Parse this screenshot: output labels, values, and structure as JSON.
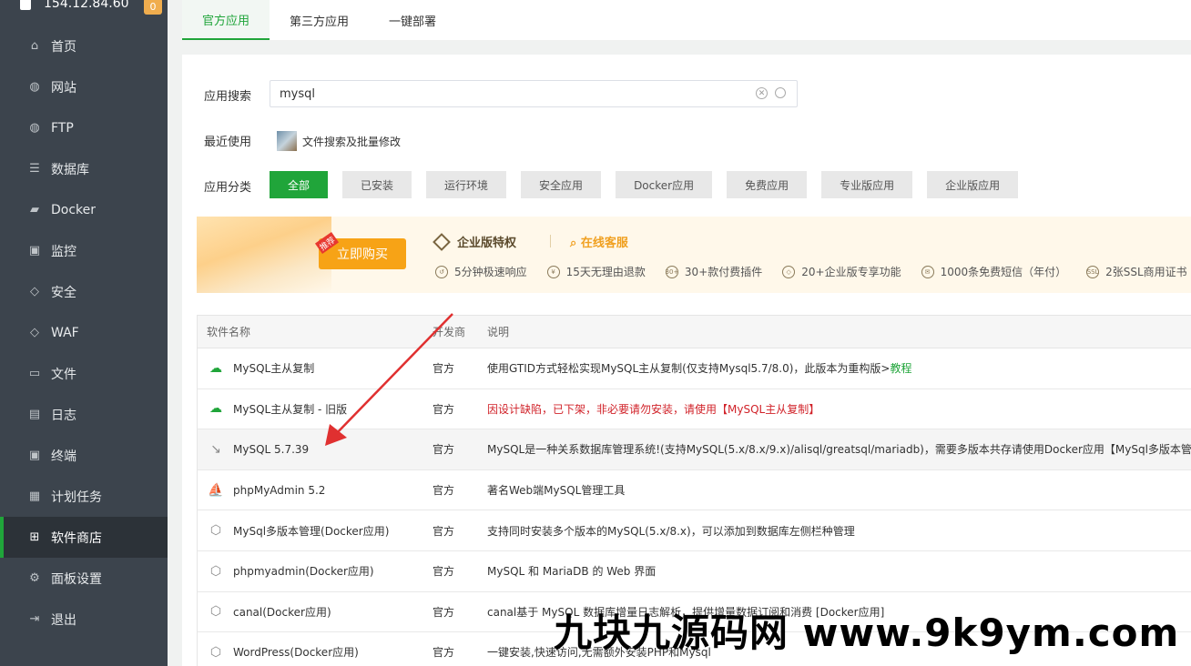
{
  "sidebar": {
    "host": "154.12.84.60",
    "badge": "0",
    "items": [
      {
        "label": "首页",
        "icon": "home-icon",
        "glyph": "⌂"
      },
      {
        "label": "网站",
        "icon": "globe-icon",
        "glyph": "◍"
      },
      {
        "label": "FTP",
        "icon": "ftp-icon",
        "glyph": "◍"
      },
      {
        "label": "数据库",
        "icon": "database-icon",
        "glyph": "☰"
      },
      {
        "label": "Docker",
        "icon": "docker-icon",
        "glyph": "▰"
      },
      {
        "label": "监控",
        "icon": "monitor-icon",
        "glyph": "▣"
      },
      {
        "label": "安全",
        "icon": "shield-icon",
        "glyph": "◇"
      },
      {
        "label": "WAF",
        "icon": "waf-icon",
        "glyph": "◇"
      },
      {
        "label": "文件",
        "icon": "folder-icon",
        "glyph": "▭"
      },
      {
        "label": "日志",
        "icon": "log-icon",
        "glyph": "▤"
      },
      {
        "label": "终端",
        "icon": "terminal-icon",
        "glyph": "▣"
      },
      {
        "label": "计划任务",
        "icon": "calendar-icon",
        "glyph": "▦"
      },
      {
        "label": "软件商店",
        "icon": "apps-icon",
        "glyph": "⊞"
      },
      {
        "label": "面板设置",
        "icon": "gear-icon",
        "glyph": "⚙"
      },
      {
        "label": "退出",
        "icon": "logout-icon",
        "glyph": "⇥"
      }
    ],
    "active_index": 12
  },
  "tabs": [
    "官方应用",
    "第三方应用",
    "一键部署"
  ],
  "search": {
    "label": "应用搜索",
    "value": "mysql"
  },
  "recent": {
    "label": "最近使用",
    "item": "文件搜索及批量修改"
  },
  "categories": {
    "label": "应用分类",
    "items": [
      "全部",
      "已安装",
      "运行环境",
      "安全应用",
      "Docker应用",
      "免费应用",
      "专业版应用",
      "企业版应用"
    ]
  },
  "banner": {
    "recommend": "推荐",
    "buy": "立即购买",
    "title": "企业版特权",
    "service": "在线客服",
    "perks": [
      {
        "text": "5分钟极速响应",
        "icon": "clock-icon",
        "glyph": "↺"
      },
      {
        "text": "15天无理由退款",
        "icon": "refund-icon",
        "glyph": "¥"
      },
      {
        "text": "30+款付费插件",
        "icon": "plugin-icon",
        "glyph": "30+"
      },
      {
        "text": "20+企业版专享功能",
        "icon": "diamond-icon",
        "glyph": "◇"
      },
      {
        "text": "1000条免费短信（年付）",
        "icon": "mail-icon",
        "glyph": "✉"
      },
      {
        "text": "2张SSL商用证书（",
        "icon": "ssl-icon",
        "glyph": "SSL"
      }
    ]
  },
  "table": {
    "headers": [
      "软件名称",
      "开发商",
      "说明"
    ],
    "rows": [
      {
        "name": "MySQL主从复制",
        "vendor": "官方",
        "desc": "使用GTID方式轻松实现MySQL主从复制(仅支持Mysql5.7/8.0)，此版本为重构版>",
        "link": "教程",
        "icon": "cloud-sync-icon",
        "glyph": "☁",
        "style": "green"
      },
      {
        "name": "MySQL主从复制 - 旧版",
        "vendor": "官方",
        "desc": "因设计缺陷，已下架，非必要请勿安装，请使用【MySQL主从复制】",
        "icon": "cloud-sync-icon",
        "glyph": "☁",
        "style": "green",
        "desc_style": "red"
      },
      {
        "name": "MySQL 5.7.39",
        "vendor": "官方",
        "desc": "MySQL是一种关系数据库管理系统!(支持MySQL(5.x/8.x/9.x)/alisql/greatsql/mariadb)，需要多版本共存请使用Docker应用【MySql多版本管理",
        "icon": "dolphin-icon",
        "glyph": "↘",
        "style": "gray"
      },
      {
        "name": "phpMyAdmin 5.2",
        "vendor": "官方",
        "desc": "著名Web端MySQL管理工具",
        "icon": "sail-icon",
        "glyph": "⛵",
        "style": "orange"
      },
      {
        "name": "MySql多版本管理(Docker应用)",
        "vendor": "官方",
        "desc": "支持同时安装多个版本的MySQL(5.x/8.x)，可以添加到数据库左侧栏种管理",
        "icon": "box-icon",
        "glyph": "⬡",
        "style": "gray"
      },
      {
        "name": "phpmyadmin(Docker应用)",
        "vendor": "官方",
        "desc": "MySQL 和 MariaDB 的 Web 界面",
        "icon": "box-icon",
        "glyph": "⬡",
        "style": "gray"
      },
      {
        "name": "canal(Docker应用)",
        "vendor": "官方",
        "desc": "canal基于 MySQL 数据库增量日志解析，提供增量数据订阅和消费 [Docker应用]",
        "icon": "box-icon",
        "glyph": "⬡",
        "style": "gray"
      },
      {
        "name": "WordPress(Docker应用)",
        "vendor": "官方",
        "desc": "一键安装,快速访问,无需额外安装PHP和Mysql",
        "icon": "box-icon",
        "glyph": "⬡",
        "style": "gray"
      }
    ],
    "hover_index": 2
  },
  "watermark": "九块九源码网 www.9k9ym.com"
}
